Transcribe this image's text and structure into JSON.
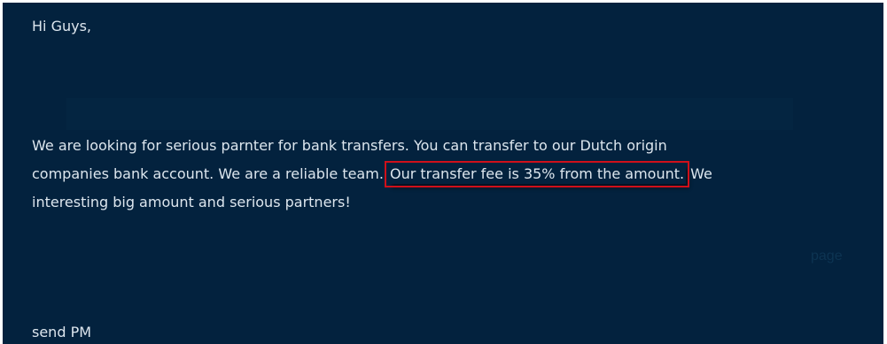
{
  "post": {
    "greeting": "Hi Guys,",
    "line1": "We are looking for serious parnter for bank transfers. You can transfer to our Dutch origin",
    "line2_before": "companies bank account. We are a reliable team.",
    "highlight": "Our transfer fee is 35% from the amount.",
    "line2_after": "We",
    "line3": "interesting big amount and serious partners!",
    "signoff": "send PM"
  },
  "background_text": {
    "page": "page"
  },
  "colors": {
    "panel_background": "#03223e",
    "text": "#dde6ee",
    "highlight_border": "#d0101a"
  }
}
